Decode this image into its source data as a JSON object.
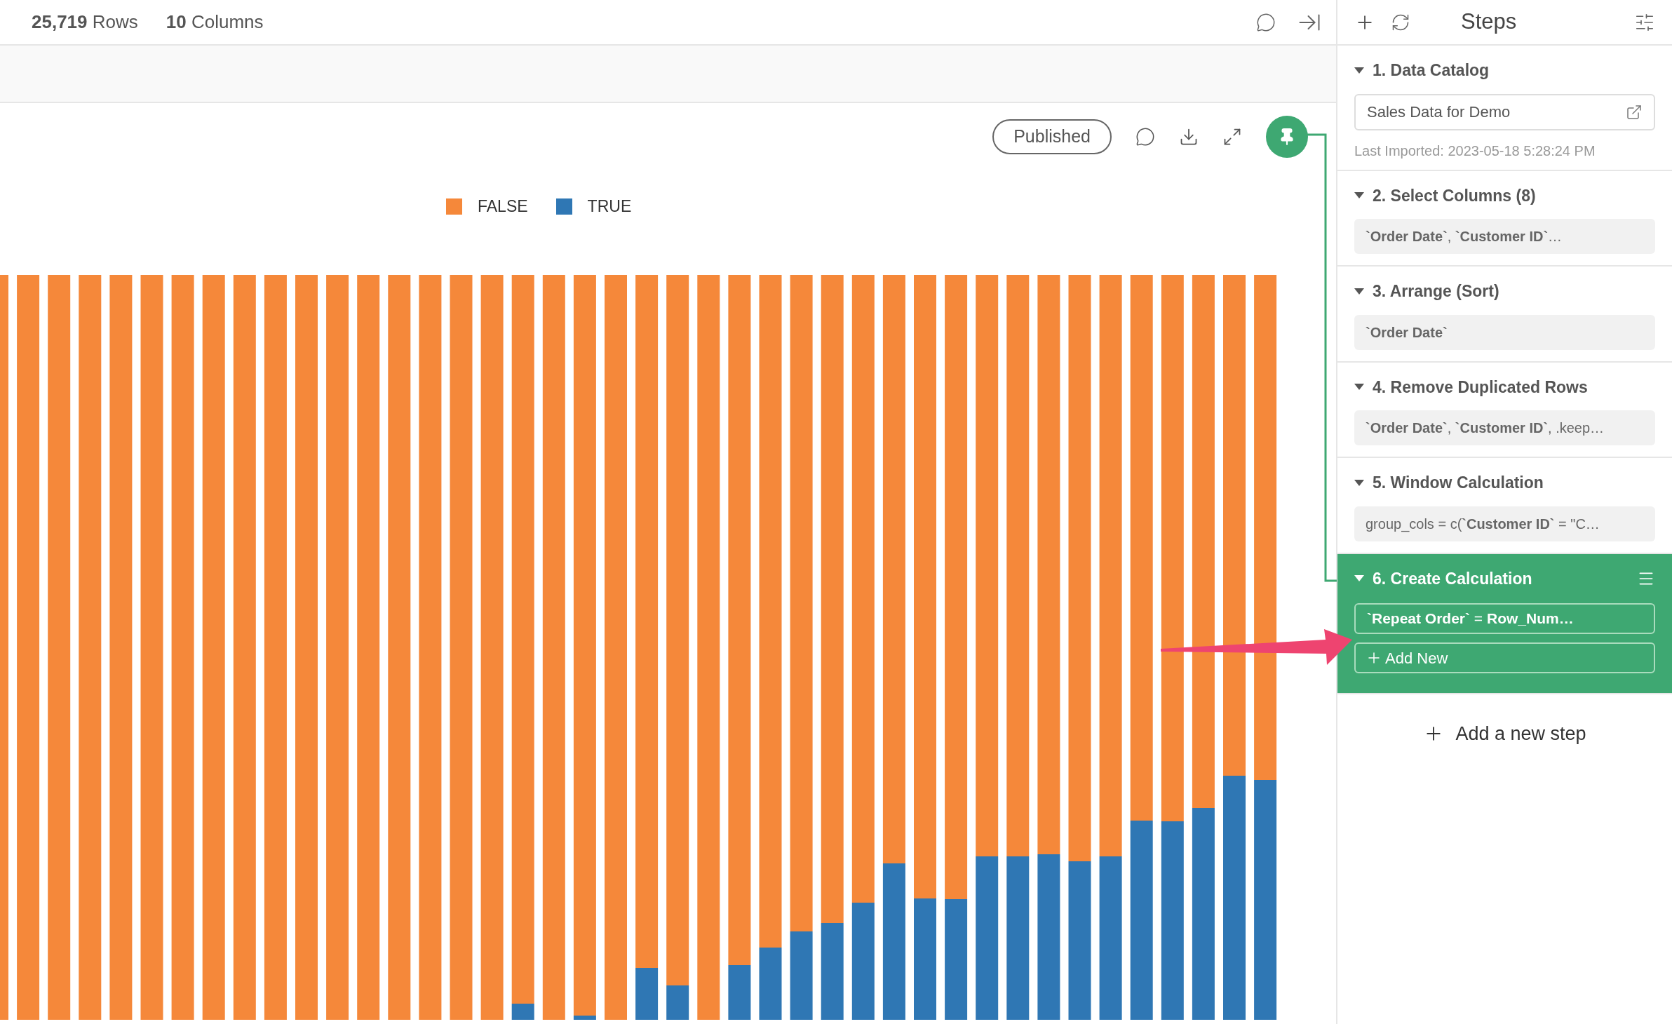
{
  "header": {
    "rows": "**25,719** Rows",
    "columns": "**10** Columns"
  },
  "chart_toolbar": {
    "status": "Published"
  },
  "legend": [
    {
      "label": "FALSE",
      "color": "#f5883a"
    },
    {
      "label": "TRUE",
      "color": "#2f77b4"
    }
  ],
  "steps_panel": {
    "title": "Steps",
    "steps": [
      {
        "kind": "catalog",
        "title": "1. Data Catalog",
        "expanded": true,
        "selected": false,
        "value": "Sales Data for Demo",
        "note": "Last Imported: 2023-05-18 5:28:24 PM"
      },
      {
        "kind": "summary",
        "title": "2. Select Columns (8)",
        "expanded": true,
        "selected": false,
        "value": "**`Order Date`**, **`Customer ID`**…"
      },
      {
        "kind": "summary",
        "title": "3. Arrange (Sort)",
        "expanded": true,
        "selected": false,
        "value": "**`Order Date`**"
      },
      {
        "kind": "summary",
        "title": "4. Remove Duplicated Rows",
        "expanded": true,
        "selected": false,
        "value": "**`Order Date`**, **`Customer ID`**, .keep…"
      },
      {
        "kind": "summary",
        "title": "5. Window Calculation",
        "expanded": true,
        "selected": false,
        "value": "group_cols = c(**`Customer ID`** = \"C…"
      },
      {
        "kind": "calculation",
        "title": "6. Create Calculation",
        "expanded": true,
        "selected": true,
        "items": [
          "**`Repeat Order`** = **Row_Num…**"
        ],
        "add_new": "Add New"
      }
    ],
    "add_step": "Add a new step"
  }
}
